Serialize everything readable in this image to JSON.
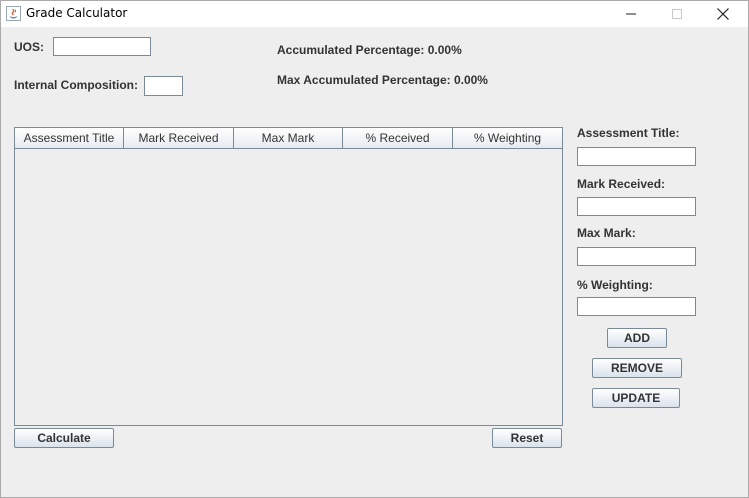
{
  "window": {
    "title": "Grade Calculator"
  },
  "top": {
    "uos_label": "UOS:",
    "uos_value": "",
    "internal_label": "Internal Composition:",
    "internal_value": "",
    "accumulated": "Accumulated Percentage: 0.00%",
    "max_accumulated": "Max Accumulated Percentage: 0.00%"
  },
  "table": {
    "columns": [
      "Assessment Title",
      "Mark Received",
      "Max Mark",
      "% Received",
      "% Weighting"
    ],
    "rows": []
  },
  "form": {
    "title_label": "Assessment Title:",
    "title_value": "",
    "mark_label": "Mark Received:",
    "mark_value": "",
    "max_label": "Max Mark:",
    "max_value": "",
    "weight_label": "% Weighting:",
    "weight_value": ""
  },
  "buttons": {
    "add": "ADD",
    "remove": "REMOVE",
    "update": "UPDATE",
    "calculate": "Calculate",
    "reset": "Reset"
  }
}
